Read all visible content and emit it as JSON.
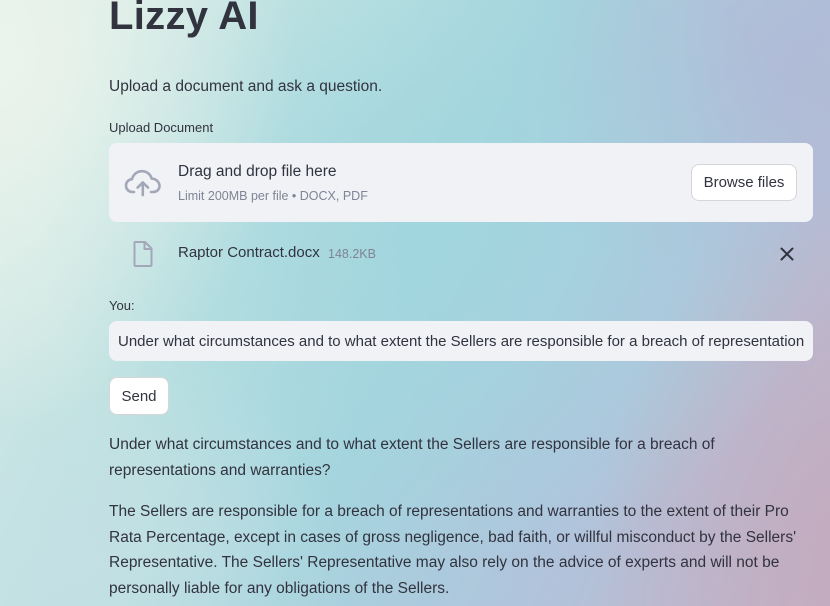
{
  "app": {
    "title": "Lizzy AI",
    "subtitle": "Upload a document and ask a question."
  },
  "uploader": {
    "label": "Upload Document",
    "drop_title": "Drag and drop file here",
    "limit_text": "Limit 200MB per file • DOCX, PDF",
    "browse_label": "Browse files",
    "file": {
      "name": "Raptor Contract.docx",
      "size": "148.2KB"
    }
  },
  "chat": {
    "input_label": "You:",
    "input_value": "Under what circumstances and to what extent the Sellers are responsible for a breach of representations and warranties?",
    "send_label": "Send",
    "question": "Under what circumstances and to what extent the Sellers are responsible for a breach of representations and warranties?",
    "answer": "The Sellers are responsible for a breach of representations and warranties to the extent of their Pro Rata Percentage, except in cases of gross negligence, bad faith, or willful misconduct by the Sellers' Representative. The Sellers' Representative may also rely on the advice of experts and will not be personally liable for any obligations of the Sellers."
  },
  "icons": {
    "upload": "cloud-upload-icon",
    "file": "file-icon",
    "remove": "close-icon"
  },
  "colors": {
    "text": "#31333f",
    "muted": "#808495",
    "input_bg": "#f0f2f6",
    "icon": "#a3a8b8"
  }
}
